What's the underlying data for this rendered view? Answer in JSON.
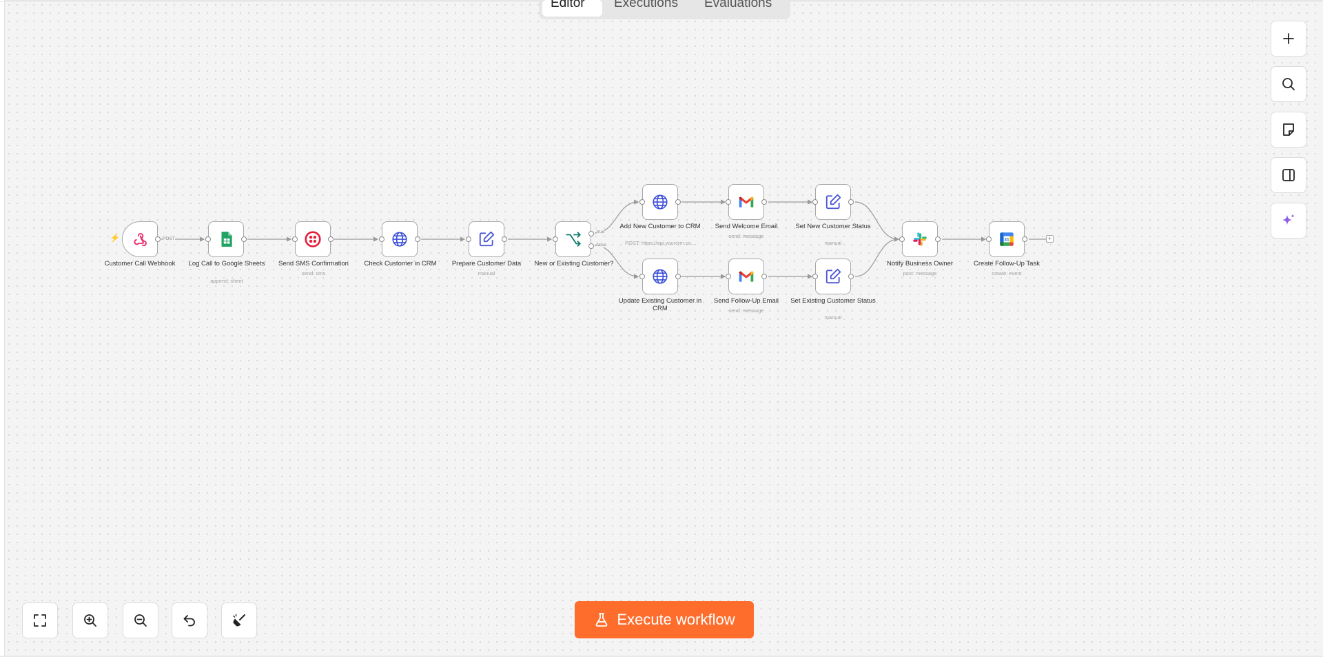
{
  "tabs": [
    {
      "label": "Editor",
      "active": true
    },
    {
      "label": "Executions",
      "active": false
    },
    {
      "label": "Evaluations",
      "active": false
    }
  ],
  "nodes": {
    "webhook": {
      "label": "Customer Call Webhook",
      "sub": "",
      "icon": "webhook-icon"
    },
    "sheets": {
      "label": "Log Call to Google Sheets",
      "sub": "append: sheet",
      "icon": "google-sheets-icon"
    },
    "sms": {
      "label": "Send SMS Confirmation",
      "sub": "send: sms",
      "icon": "twilio-icon"
    },
    "check_crm": {
      "label": "Check Customer in CRM",
      "sub": "",
      "icon": "globe-icon"
    },
    "prepare": {
      "label": "Prepare Customer Data",
      "sub": "manual",
      "icon": "edit-icon"
    },
    "if": {
      "label": "New or Existing Customer?",
      "sub": "",
      "icon": "branch-icon"
    },
    "add_crm": {
      "label": "Add New Customer to CRM",
      "sub": "POST: https://api.yourcrm.co...",
      "icon": "globe-icon"
    },
    "welcome": {
      "label": "Send Welcome Email",
      "sub": "send: message",
      "icon": "gmail-icon"
    },
    "set_new": {
      "label": "Set New Customer Status",
      "sub": "manual",
      "icon": "edit-icon"
    },
    "update_crm": {
      "label": "Update Existing Customer in CRM",
      "sub": "",
      "icon": "globe-icon"
    },
    "followup": {
      "label": "Send Follow-Up Email",
      "sub": "send: message",
      "icon": "gmail-icon"
    },
    "set_existing": {
      "label": "Set Existing Customer Status",
      "sub": "manual",
      "icon": "edit-icon"
    },
    "notify": {
      "label": "Notify Business Owner",
      "sub": "post: message",
      "icon": "slack-icon"
    },
    "task": {
      "label": "Create Follow-Up Task",
      "sub": "create: event",
      "icon": "google-calendar-icon"
    }
  },
  "edge_labels": {
    "post": "POST",
    "true": "true",
    "false": "false"
  },
  "calendar_day": "31",
  "right_toolbar": [
    {
      "name": "add-node-button",
      "icon": "plus-icon"
    },
    {
      "name": "search-nodes-button",
      "icon": "search-icon"
    },
    {
      "name": "sticky-note-button",
      "icon": "sticky-note-icon"
    },
    {
      "name": "toggle-panel-button",
      "icon": "panel-icon"
    },
    {
      "name": "ai-assistant-button",
      "icon": "sparkle-icon"
    }
  ],
  "bottom_toolbar": [
    {
      "name": "fit-view-button",
      "icon": "fullscreen-icon"
    },
    {
      "name": "zoom-in-button",
      "icon": "zoom-in-icon"
    },
    {
      "name": "zoom-out-button",
      "icon": "zoom-out-icon"
    },
    {
      "name": "undo-button",
      "icon": "undo-icon"
    },
    {
      "name": "tidy-up-button",
      "icon": "broom-icon"
    }
  ],
  "execute": {
    "label": "Execute workflow",
    "color": "#ff6d2d"
  }
}
